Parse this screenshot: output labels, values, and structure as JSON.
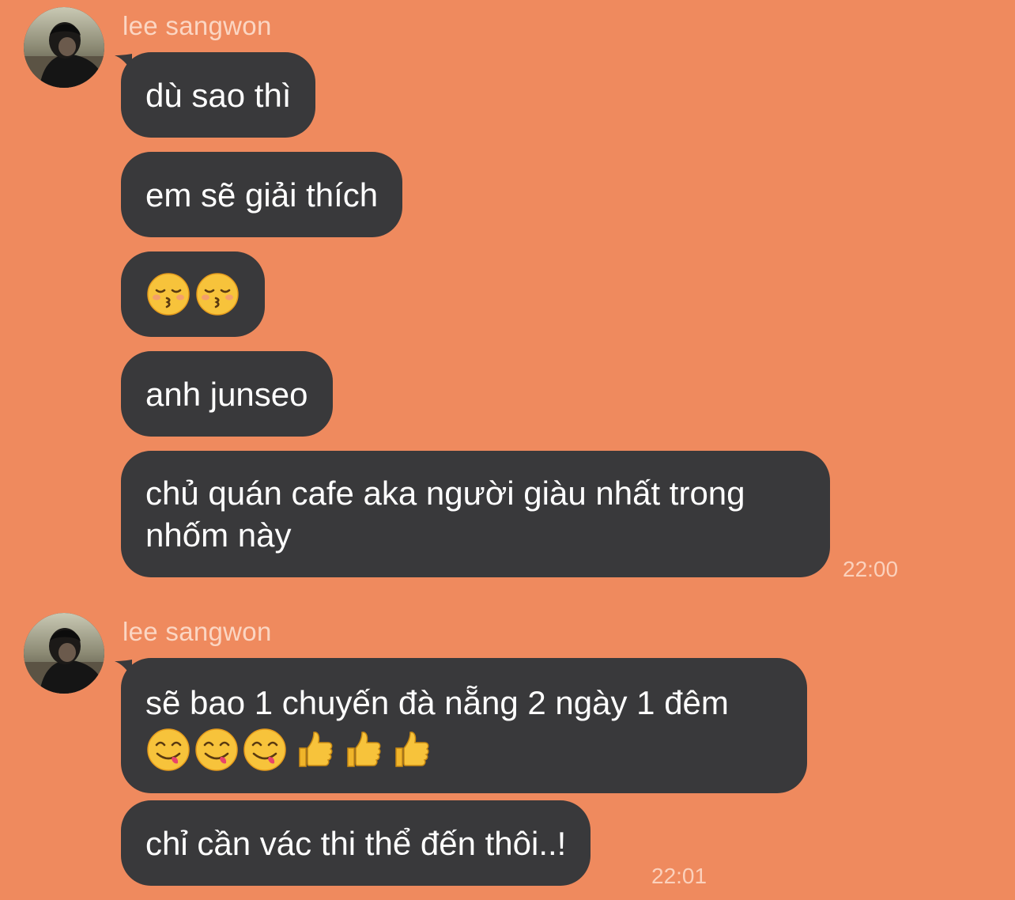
{
  "groups": [
    {
      "sender": "lee sangwon",
      "timestamp": "22:00",
      "messages": [
        {
          "text": "dù sao thì"
        },
        {
          "text": "em sẽ giải thích"
        },
        {
          "emojis": [
            "kissing-face-with-closed-eyes",
            "kissing-face-with-closed-eyes"
          ]
        },
        {
          "text": "anh junseo"
        },
        {
          "line1": "chủ quán cafe aka người giàu nhất trong",
          "line2": "nhốm này"
        }
      ]
    },
    {
      "sender": "lee sangwon",
      "timestamp": "22:01",
      "messages": [
        {
          "line1": "sẽ bao 1 chuyến đà nẵng 2 ngày 1 đêm",
          "emojis": [
            "face-savoring-food",
            "face-savoring-food",
            "face-savoring-food",
            "thumbs-up",
            "thumbs-up",
            "thumbs-up"
          ]
        },
        {
          "text": "chỉ cần vác thi thể đến thôi..!"
        }
      ]
    }
  ],
  "colors": {
    "background": "#ef8a5e",
    "bubble": "#39393b",
    "bubble_text": "#ffffff",
    "meta_text": "#fbd6c3"
  }
}
